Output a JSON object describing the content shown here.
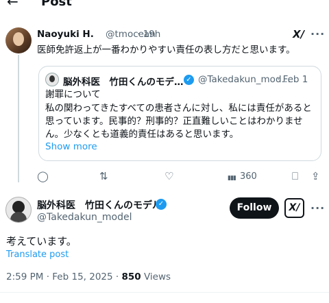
{
  "header": {
    "back_icon": "arrow-left-icon",
    "back": "←",
    "title": "Post"
  },
  "parent_post": {
    "author_name": "Naoyuki H.",
    "handle": "@tmocean",
    "time": "· 19h",
    "text": "医師免許返上が一番わかりやすい責任の表し方だと思います。",
    "grok_label": "X/",
    "more_label": "···",
    "quote": {
      "author_name": "脳外科医　竹田くんのモデ…",
      "verified": "✓",
      "handle": "@Takedakun_mod…",
      "date": "· Feb 1",
      "lines": [
        "謝罪について",
        "私の関わってきたすべての患者さんに対し、私には責任があると",
        "思っています。民事的？刑事的？正直難しいことはわかりませ",
        "ん。少なくとも道義的責任はあると思います。"
      ],
      "show_more": "Show more"
    },
    "actions": {
      "reply": "◯",
      "repost": "⇅",
      "like": "♡",
      "views_icon": "▮▮▮",
      "views": "360",
      "bookmark": "⎕",
      "share": "⇪"
    }
  },
  "main_post": {
    "author_name": "脳外科医　竹田くんのモデル",
    "verified": "✓",
    "handle": "@Takedakun_model",
    "follow_label": "Follow",
    "grok_label": "X/",
    "more_label": "···",
    "text": "考えています。",
    "translate": "Translate post",
    "time": "2:59 PM",
    "date": "Feb 15, 2025",
    "views_count": "850",
    "views_label": "Views"
  },
  "colors": {
    "accent": "#1d9bf0",
    "text": "#0f1419",
    "muted": "#536471",
    "border": "#cfd9de"
  }
}
